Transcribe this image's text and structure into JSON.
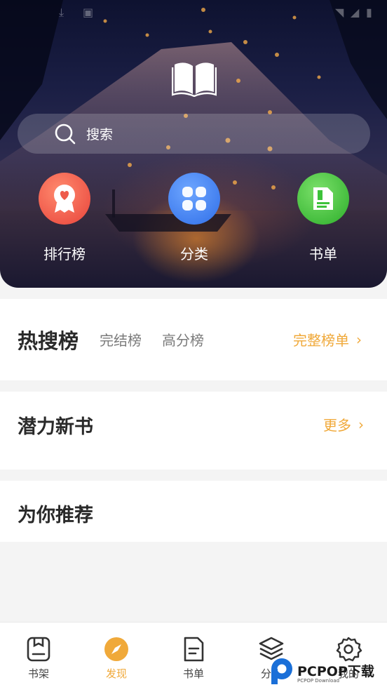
{
  "search": {
    "placeholder": "搜索"
  },
  "quick_entries": [
    {
      "label": "排行榜",
      "icon": "ranking-badge-icon"
    },
    {
      "label": "分类",
      "icon": "category-grid-icon"
    },
    {
      "label": "书单",
      "icon": "booklist-icon"
    }
  ],
  "hot_section": {
    "title": "热搜榜",
    "tabs": [
      "完结榜",
      "高分榜"
    ],
    "more": "完整榜单"
  },
  "new_books": {
    "title": "潜力新书",
    "more": "更多"
  },
  "recommend": {
    "title": "为你推荐"
  },
  "bottom_nav": [
    {
      "label": "书架",
      "icon": "bookshelf-icon"
    },
    {
      "label": "发现",
      "icon": "compass-icon",
      "active": true
    },
    {
      "label": "书单",
      "icon": "document-icon"
    },
    {
      "label": "分类",
      "icon": "layers-icon"
    },
    {
      "label": "我的",
      "icon": "gear-icon"
    }
  ],
  "watermark": {
    "text": "PCPOP下载",
    "subtext": "PCPOP Download"
  },
  "colors": {
    "accent": "#f0a93a",
    "rank_red": "#f0584a",
    "category_blue": "#3d7ef0",
    "booklist_green": "#3dc23a"
  }
}
